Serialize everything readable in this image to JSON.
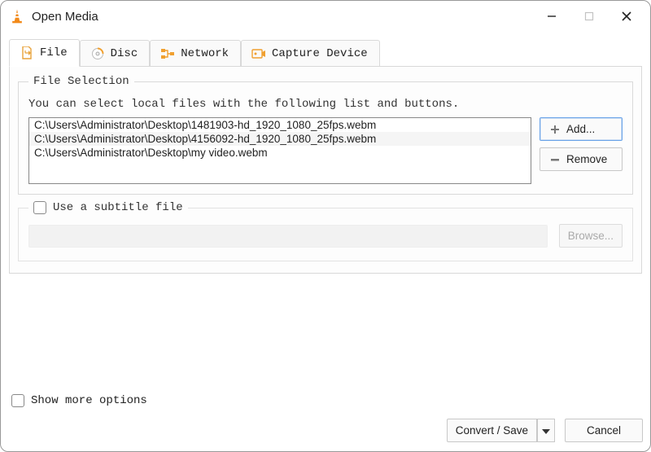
{
  "window": {
    "title": "Open Media"
  },
  "tabs": {
    "file": "File",
    "disc": "Disc",
    "network": "Network",
    "capture": "Capture Device"
  },
  "fileSelection": {
    "legend": "File Selection",
    "hint": "You can select local files with the following list and buttons.",
    "files": [
      "C:\\Users\\Administrator\\Desktop\\1481903-hd_1920_1080_25fps.webm",
      "C:\\Users\\Administrator\\Desktop\\4156092-hd_1920_1080_25fps.webm",
      "C:\\Users\\Administrator\\Desktop\\my video.webm"
    ],
    "addLabel": "Add...",
    "removeLabel": "Remove"
  },
  "subtitle": {
    "legend": "Use a subtitle file",
    "browse": "Browse..."
  },
  "footer": {
    "moreOptions": "Show more options",
    "convertSave": "Convert / Save",
    "cancel": "Cancel"
  }
}
